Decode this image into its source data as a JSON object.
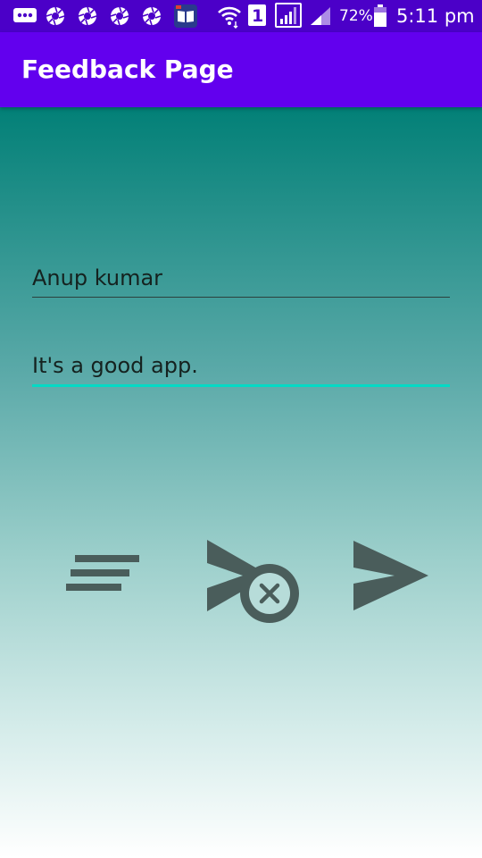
{
  "status_bar": {
    "battery_percent": "72%",
    "time": "5:11 pm",
    "sim_slot": "1",
    "icons": [
      "messaging-icon",
      "shutter-icon",
      "shutter-icon",
      "shutter-icon",
      "shutter-icon",
      "book-icon",
      "wifi-icon",
      "sim-1-icon",
      "signal-icon",
      "signal-icon",
      "battery-icon"
    ]
  },
  "app_bar": {
    "title": "Feedback Page",
    "color": "#6200ee"
  },
  "form": {
    "name_value": "Anup kumar",
    "feedback_value": "It's a good app.",
    "accent_color": "#03dac5"
  },
  "actions": [
    {
      "icon": "list-icon"
    },
    {
      "icon": "cancel-send-icon"
    },
    {
      "icon": "send-icon"
    }
  ]
}
